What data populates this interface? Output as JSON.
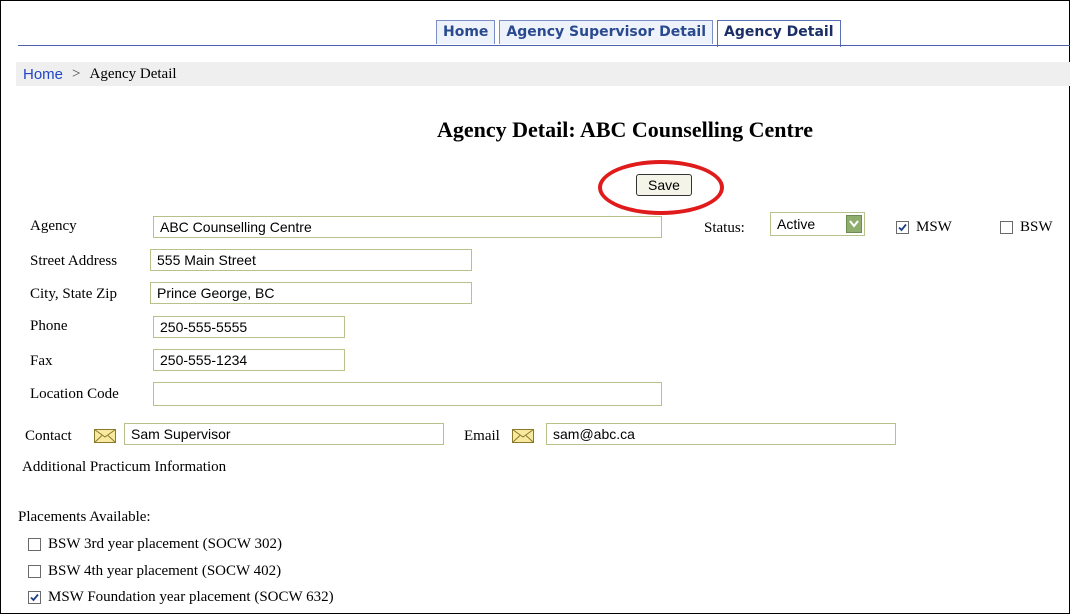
{
  "tabs": [
    {
      "label": "Home"
    },
    {
      "label": "Agency Supervisor Detail"
    },
    {
      "label": "Agency Detail"
    }
  ],
  "breadcrumb": {
    "home": "Home",
    "separator": ">",
    "current": "Agency Detail"
  },
  "page_title": "Agency Detail: ABC Counselling Centre",
  "save_label": "Save",
  "form": {
    "agency_label": "Agency",
    "agency_value": "ABC Counselling Centre",
    "status_label": "Status:",
    "status_value": "Active",
    "msw_label": "MSW",
    "msw_checked": true,
    "bsw_label": "BSW",
    "bsw_checked": false,
    "street_label": "Street Address",
    "street_value": "555 Main Street",
    "city_label": "City, State Zip",
    "city_value": "Prince George, BC",
    "phone_label": "Phone",
    "phone_value": "250-555-5555",
    "fax_label": "Fax",
    "fax_value": "250-555-1234",
    "location_label": "Location Code",
    "location_value": "",
    "contact_label": "Contact",
    "contact_value": "Sam Supervisor",
    "email_label": "Email",
    "email_value": "sam@abc.ca",
    "additional_info": "Additional Practicum Information"
  },
  "placements": {
    "heading": "Placements Available:",
    "items": [
      {
        "label": "BSW 3rd year placement (SOCW 302)",
        "checked": false
      },
      {
        "label": "BSW 4th year placement (SOCW 402)",
        "checked": false
      },
      {
        "label": "MSW Foundation year placement (SOCW 632)",
        "checked": true
      }
    ]
  },
  "colors": {
    "accent": "#e01b1b",
    "tab_text": "#2a4a8f",
    "link": "#1f47c4",
    "field_border": "#b6c28a"
  }
}
